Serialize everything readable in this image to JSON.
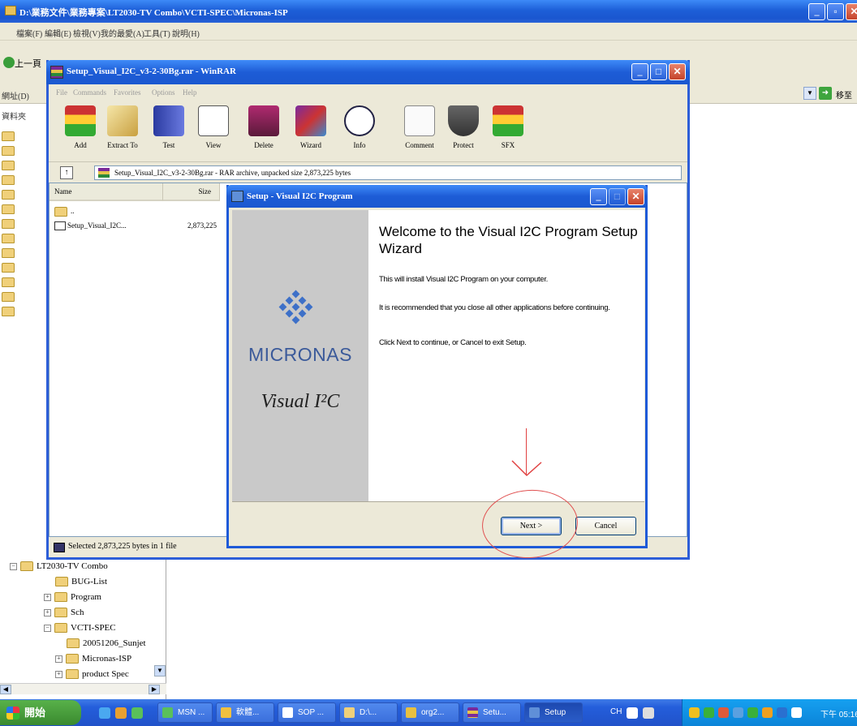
{
  "explorer": {
    "title": "D:\\業務文件\\業務專案\\LT2030-TV Combo\\VCTI-SPEC\\Micronas-ISP",
    "menu": [
      "檔案(F)",
      "編輯(E)",
      "檢視(V)",
      "我的最愛(A)",
      "工具(T)",
      "說明(H)"
    ],
    "back_label": "上一頁",
    "address_label": "網址(D)",
    "go_label": "移至",
    "folders_pane_label": "資料夾",
    "tree": [
      {
        "label": "LT2030-TV Combo",
        "expander": "−"
      },
      {
        "label": "BUG-List",
        "expander": ""
      },
      {
        "label": "Program",
        "expander": "+"
      },
      {
        "label": "Sch",
        "expander": "+"
      },
      {
        "label": "VCTI-SPEC",
        "expander": "−"
      },
      {
        "label": "20051206_Sunjet",
        "expander": ""
      },
      {
        "label": "Micronas-ISP",
        "expander": "+"
      },
      {
        "label": "product Spec",
        "expander": "+"
      }
    ]
  },
  "winrar": {
    "title": "Setup_Visual_I2C_v3-2-30Bg.rar - WinRAR",
    "menu": [
      "File",
      "Commands",
      "Favorites",
      "Options",
      "Help"
    ],
    "toolbar": [
      "Add",
      "Extract To",
      "Test",
      "View",
      "Delete",
      "Wizard",
      "Info",
      "Comment",
      "Protect",
      "SFX"
    ],
    "path": "Setup_Visual_I2C_v3-2-30Bg.rar - RAR archive, unpacked size 2,873,225 bytes",
    "columns": [
      "Name",
      "Size"
    ],
    "files": [
      {
        "name": "..",
        "size": ""
      },
      {
        "name": "Setup_Visual_I2C...",
        "size": "2,873,225"
      }
    ],
    "status": "Selected 2,873,225 bytes in 1 file"
  },
  "setup": {
    "title": "Setup - Visual I2C Program",
    "brand": "MICRONAS",
    "product": "Visual I²C",
    "heading": "Welcome to the Visual I2C Program Setup Wizard",
    "p1": "This will install Visual I2C Program on your computer.",
    "p2": "It is recommended that you close all other applications before continuing.",
    "p3": "Click Next to continue, or Cancel to exit Setup.",
    "next_label": "Next >",
    "cancel_label": "Cancel",
    "annotation_color": "#e04040"
  },
  "taskbar": {
    "start_label": "開始",
    "buttons": [
      "MSN ...",
      "軟體...",
      "SOP ...",
      "D:\\...",
      "org2...",
      "Setu...",
      "Setup"
    ],
    "ime": "CH",
    "clock": "下午 05:16"
  }
}
